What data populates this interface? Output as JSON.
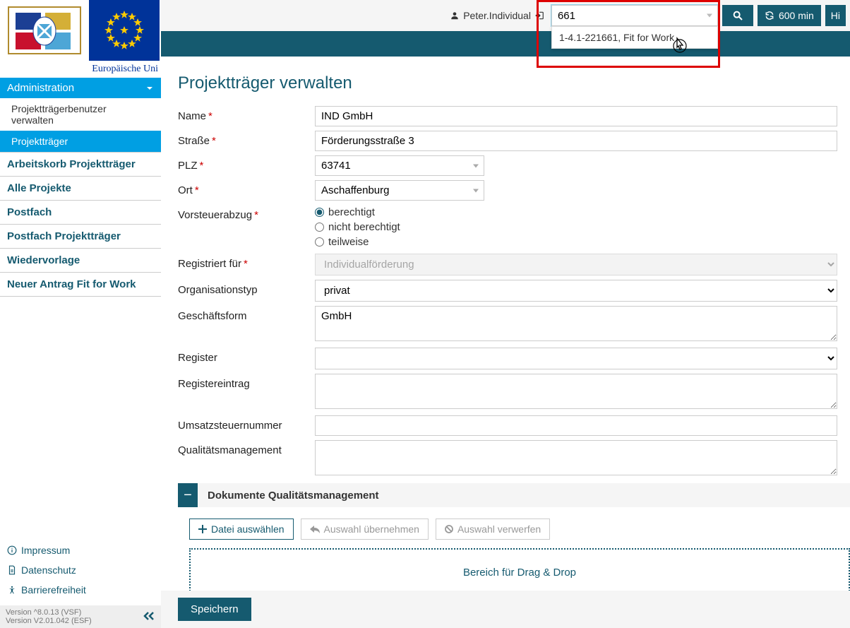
{
  "header": {
    "user_name": "Peter.Individual",
    "search_value": "661",
    "dropdown_item": "1-4.1-221661, Fit for Work",
    "timer_label": "600 min",
    "help_label": "Hi"
  },
  "logos": {
    "eu_caption": "Europäische Uni"
  },
  "sidebar": {
    "admin_header": "Administration",
    "sub_items": [
      "Projektträgerbenutzer verwalten",
      "Projektträger"
    ],
    "nav_links": [
      "Arbeitskorb Projektträger",
      "Alle Projekte",
      "Postfach",
      "Postfach Projektträger",
      "Wiedervorlage",
      "Neuer Antrag Fit for Work"
    ],
    "footer_links": [
      "Impressum",
      "Datenschutz",
      "Barrierefreiheit"
    ],
    "version_a": "Version ^8.0.13 (VSF)",
    "version_b": "Version V2.01.042 (ESF)"
  },
  "page": {
    "title": "Projektträger verwalten",
    "labels": {
      "name": "Name",
      "strasse": "Straße",
      "plz": "PLZ",
      "ort": "Ort",
      "vorsteuer": "Vorsteuerabzug",
      "registriert": "Registriert für",
      "orgtyp": "Organisationstyp",
      "geschaeftsform": "Geschäftsform",
      "register": "Register",
      "registereintrag": "Registereintrag",
      "ust": "Umsatzsteuernummer",
      "qm": "Qualitätsmanagement"
    },
    "values": {
      "name": "IND GmbH",
      "strasse": "Förderungsstraße 3",
      "plz": "63741",
      "ort": "Aschaffenburg",
      "registriert": "Individualförderung",
      "orgtyp": "privat",
      "geschaeftsform": "GmbH",
      "register": "",
      "registereintrag": "",
      "ust": "",
      "qm": ""
    },
    "radios": {
      "opt1": "berechtigt",
      "opt2": "nicht berechtigt",
      "opt3": "teilweise"
    },
    "section_title": "Dokumente Qualitätsmanagement",
    "buttons": {
      "choose": "Datei auswählen",
      "apply": "Auswahl übernehmen",
      "discard": "Auswahl verwerfen",
      "save": "Speichern"
    },
    "dropzone": "Bereich für Drag & Drop"
  }
}
